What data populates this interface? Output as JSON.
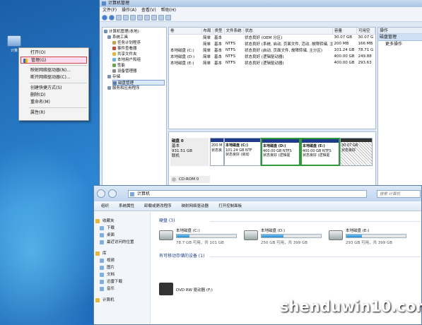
{
  "desktop": {
    "icon_label": "计算"
  },
  "context_menu": {
    "items": [
      "打开(O)",
      "管理(G)",
      "映射网络驱动器(N)...",
      "断开网络驱动器(C)...",
      "创建快捷方式(S)",
      "删除(D)",
      "重命名(M)",
      "属性(R)"
    ],
    "selected": "管理(G)"
  },
  "cm": {
    "title": "计算机管理",
    "menu": [
      "文件(F)",
      "操作(A)",
      "查看(V)",
      "帮助(H)"
    ],
    "tree": [
      "计算机管理(本地)",
      "系统工具",
      "任务计划程序",
      "事件查看器",
      "共享文件夹",
      "本地用户和组",
      "性能",
      "设备管理器",
      "存储",
      "磁盘管理",
      "服务和应用程序"
    ],
    "columns": [
      "卷",
      "布局",
      "类型",
      "文件系统",
      "状态",
      "容量",
      "可用空"
    ],
    "rows": [
      [
        "",
        "简单",
        "基本",
        "",
        "状态良好 (OEM 分区)",
        "30.07 GB",
        "30.07 G"
      ],
      [
        "",
        "简单",
        "基本",
        "NTFS",
        "状态良好 (系统, 启动, 页面文件, 活动, 故障转储, 主分区)",
        "200 MB",
        "166 MB"
      ],
      [
        "本地磁盘 (C:)",
        "简单",
        "基本",
        "NTFS",
        "状态良好 (启动, 页面文件, 故障转储, 主分区)",
        "101.24 GB",
        "78.71 G"
      ],
      [
        "本地磁盘 (D:)",
        "简单",
        "基本",
        "NTFS",
        "状态良好 (逻辑驱动器)",
        "400.00 GB",
        "249.88"
      ],
      [
        "本地磁盘 (E:)",
        "简单",
        "基本",
        "NTFS",
        "状态良好 (逻辑驱动器)",
        "400.00 GB",
        "293.63"
      ]
    ],
    "actions": {
      "header": "操作",
      "sub": "磁盘管理",
      "item": "更多操作"
    },
    "disk0": {
      "name": "磁盘 0",
      "type": "基本",
      "size": "931.51 GB",
      "status": "联机"
    },
    "partitions": [
      {
        "title": "",
        "lines": [
          "200 M",
          "状态良"
        ]
      },
      {
        "title": "本地磁盘 (C:)",
        "lines": [
          "101.24 GB NTF",
          "状态良好 (启动"
        ]
      },
      {
        "title": "本地磁盘 (D:)",
        "lines": [
          "400.00 GB NTFS",
          "状态良好 (逻辑驱"
        ]
      },
      {
        "title": "本地磁盘 (E:)",
        "lines": [
          "400.00 GB NTFS",
          "状态良好 (逻辑驱"
        ]
      },
      {
        "title": "",
        "lines": [
          "30.07 GB",
          "状态良好"
        ]
      }
    ],
    "cdrom": "CD-ROM 0"
  },
  "explorer": {
    "address": "计算机",
    "search_placeholder": "搜索 计算机",
    "commands": [
      "组织",
      "系统属性",
      "卸载或更改程序",
      "映射网络驱动器",
      "打开控制面板"
    ],
    "sidebar": [
      "收藏夹",
      "下载",
      "桌面",
      "最近访问的位置",
      "库",
      "视频",
      "图片",
      "文档",
      "迅雷下载",
      "音乐",
      "计算机"
    ],
    "group_disks": "硬盘 (3)",
    "drives": [
      {
        "name": "本地磁盘 (C:)",
        "size": "78.7 GB 可用，共 101 GB",
        "used_pct": 22
      },
      {
        "name": "本地磁盘 (D:)",
        "size": "250 GB 可用，共 399 GB",
        "used_pct": 37
      },
      {
        "name": "本地磁盘 (E:)",
        "size": "293 GB 可用，共 399 GB",
        "used_pct": 26
      }
    ],
    "group_removable": "有可移动存储的设备 (1)",
    "dvd": "DVD RW 驱动器 (F:)"
  },
  "watermark": "shenduwin10.com"
}
